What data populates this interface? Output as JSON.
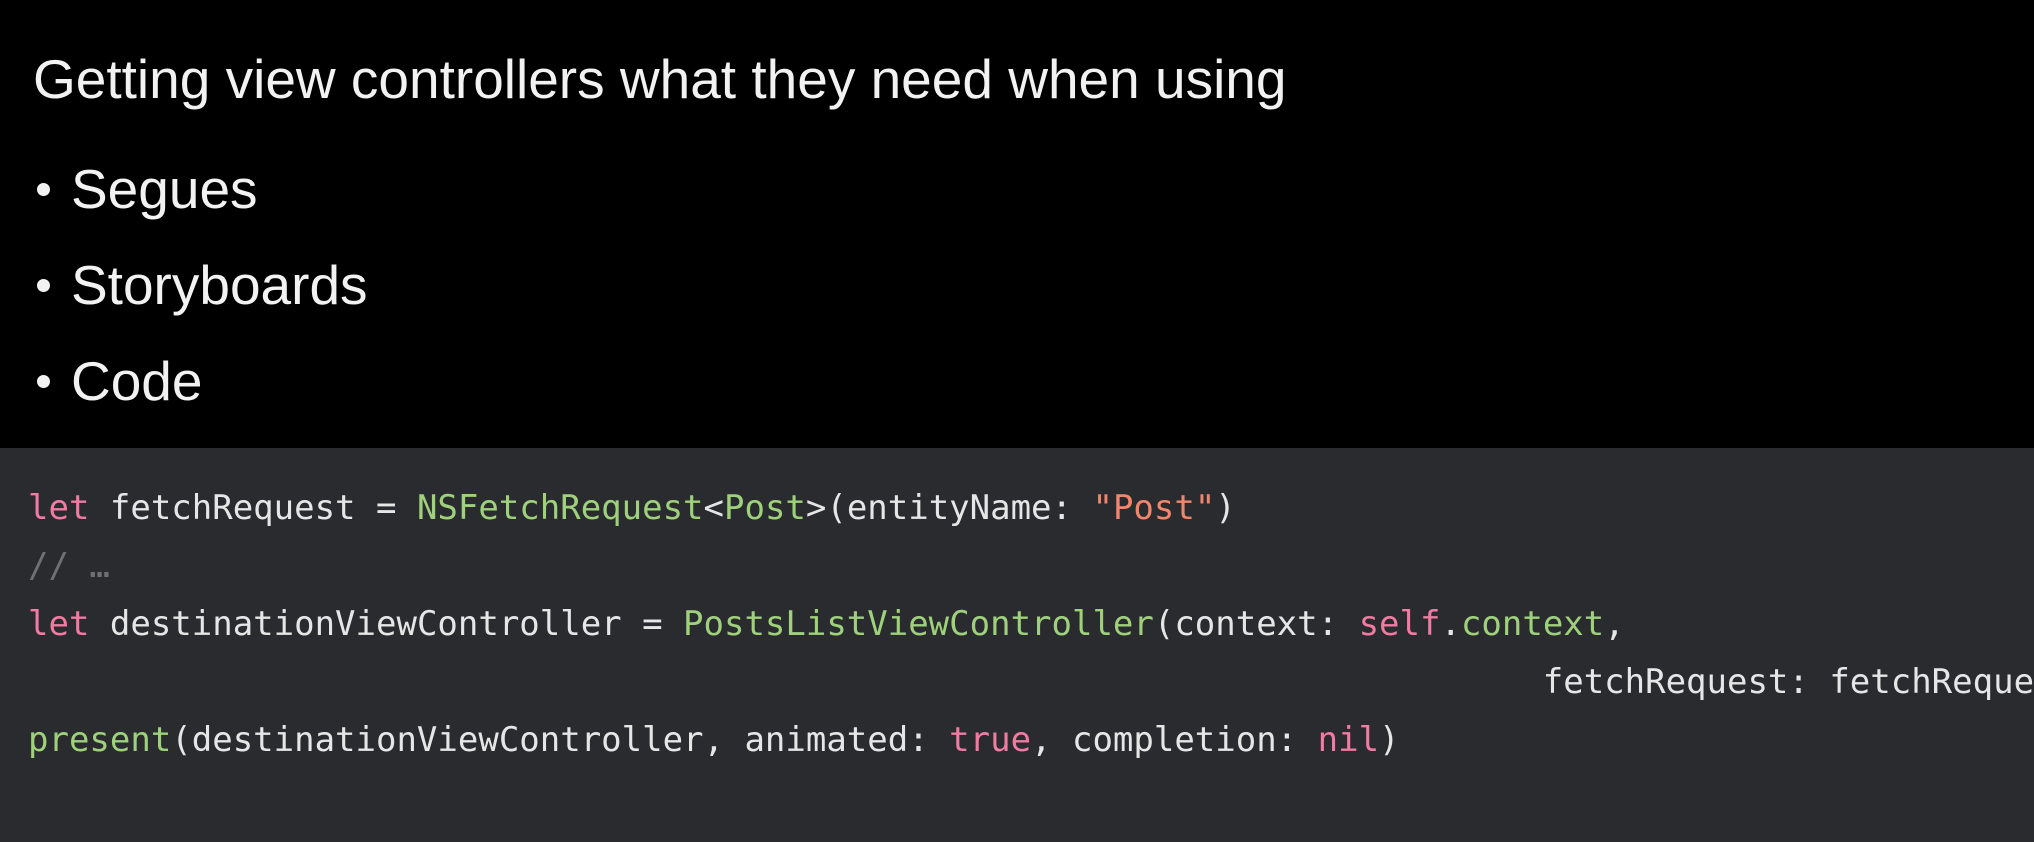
{
  "slide": {
    "heading": "Getting view controllers what they need when using",
    "bullets": [
      {
        "label": "Segues"
      },
      {
        "label": "Storyboards"
      },
      {
        "label": "Code"
      }
    ]
  },
  "code": {
    "line1": {
      "t1": "let",
      "t2": " fetchRequest = ",
      "t3": "NSFetchRequest",
      "t4": "<",
      "t5": "Post",
      "t6": ">(entityName: ",
      "t7": "\"Post\"",
      "t8": ")"
    },
    "line2": {
      "t1": "// …"
    },
    "line3": {
      "t1": "let",
      "t2": " destinationViewController = ",
      "t3": "PostsListViewController",
      "t4": "(context: ",
      "t5": "self",
      "t6": ".",
      "t7": "context",
      "t8": ","
    },
    "line4": {
      "t1": "                                                                          fetchRequest: fetchRequest)"
    },
    "line5": {
      "t1": "present",
      "t2": "(destinationViewController, animated: ",
      "t3": "true",
      "t4": ", completion: ",
      "t5": "nil",
      "t6": ")"
    }
  },
  "colors": {
    "slide_background": "#000000",
    "code_background": "#2a2b2f",
    "keyword": "#f27ba2",
    "type": "#9fd17c",
    "string": "#f0876c",
    "comment": "#6f7075",
    "plain": "#e6e6e6"
  }
}
